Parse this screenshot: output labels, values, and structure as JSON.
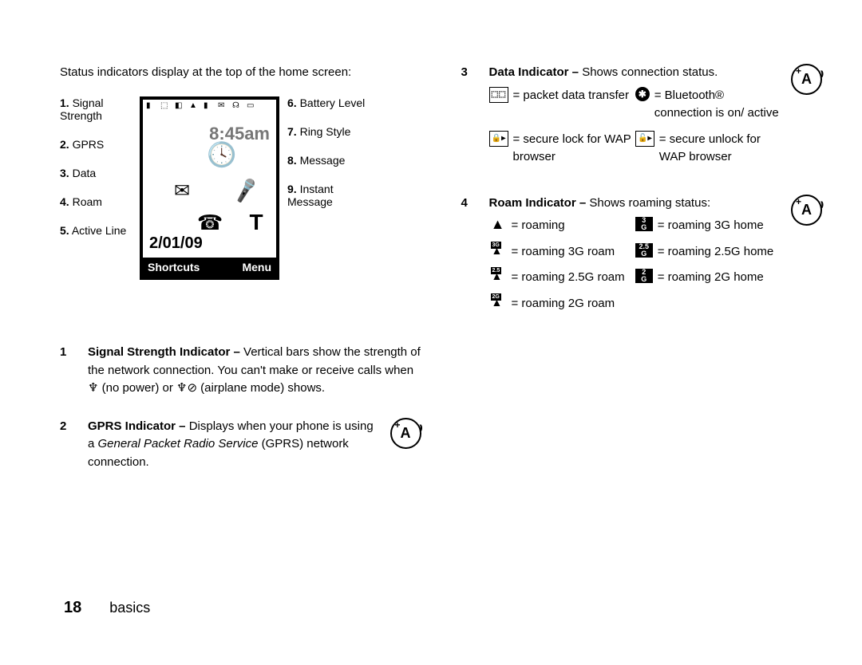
{
  "intro": "Status indicators display at the top of the home screen:",
  "phone": {
    "time": "8:45am",
    "date": "2/01/09",
    "left_softkey": "Shortcuts",
    "right_softkey": "Menu"
  },
  "callouts_left": [
    {
      "num": "1.",
      "label": "Signal Strength"
    },
    {
      "num": "2.",
      "label": "GPRS"
    },
    {
      "num": "3.",
      "label": "Data"
    },
    {
      "num": "4.",
      "label": "Roam"
    },
    {
      "num": "5.",
      "label": "Active Line"
    }
  ],
  "callouts_right": [
    {
      "num": "6.",
      "label": "Battery Level"
    },
    {
      "num": "7.",
      "label": "Ring Style"
    },
    {
      "num": "8.",
      "label": "Message"
    },
    {
      "num": "9.",
      "label": "Instant Message"
    }
  ],
  "items": [
    {
      "num": "1",
      "title": "Signal Strength Indicator –",
      "text_a": " Vertical bars show the strength of the network connection. You can't make or receive calls when ",
      "text_b": " (no power) or ",
      "text_c": " (airplane mode) shows."
    },
    {
      "num": "2",
      "title": "GPRS Indicator –",
      "text_a": " Displays when your phone is using a ",
      "italic": "General Packet Radio Service",
      "text_b": " (GPRS) network connection."
    },
    {
      "num": "3",
      "title": "Data Indicator –",
      "text_a": " Shows connection status.",
      "cells": [
        {
          "sym": "packet",
          "text": "= packet data transfer"
        },
        {
          "sym": "bluetooth",
          "text": "= Bluetooth® connection is on/ active"
        },
        {
          "sym": "lock",
          "text": "= secure lock for WAP browser"
        },
        {
          "sym": "unlock",
          "text": "= secure unlock for WAP browser"
        }
      ]
    },
    {
      "num": "4",
      "title": "Roam Indicator –",
      "text_a": " Shows roaming status:",
      "cells": [
        {
          "sym": "tri",
          "text": "= roaming"
        },
        {
          "sym": "3g-h",
          "text": "= roaming 3G home"
        },
        {
          "sym": "3g-r",
          "text": "= roaming 3G roam"
        },
        {
          "sym": "25g-h",
          "text": "= roaming 2.5G home"
        },
        {
          "sym": "25g-r",
          "text": "= roaming 2.5G roam"
        },
        {
          "sym": "2g-h",
          "text": "= roaming 2G home"
        },
        {
          "sym": "2g-r",
          "text": "= roaming 2G roam"
        }
      ]
    }
  ],
  "footer": {
    "page": "18",
    "section": "basics"
  },
  "aux_letter": "A"
}
